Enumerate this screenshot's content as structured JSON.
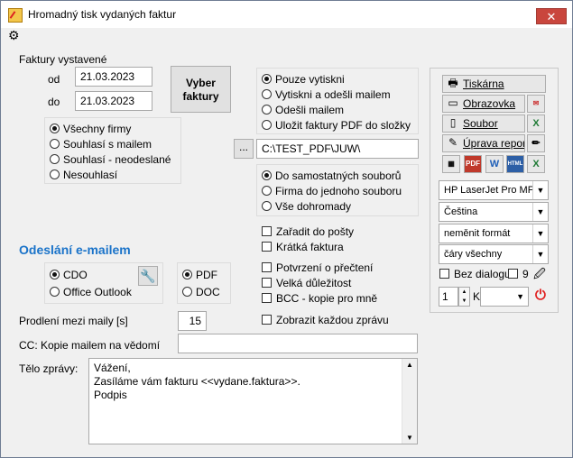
{
  "window": {
    "title": "Hromadný tisk vydaných faktur",
    "close_label": "✕"
  },
  "invoices": {
    "section_label": "Faktury vystavené",
    "from_label": "od",
    "from_value": "21.03.2023",
    "to_label": "do",
    "to_value": "21.03.2023",
    "select_button": "Vyber\nfaktury"
  },
  "companies": {
    "options": [
      "Všechny firmy",
      "Souhlasí s mailem",
      "Souhlasí - neodeslané",
      "Nesouhlasí"
    ],
    "selected": "Všechny firmy"
  },
  "action": {
    "options": [
      "Pouze vytiskni",
      "Vytiskni a odešli mailem",
      "Odešli mailem",
      "Uložit faktury PDF do složky"
    ],
    "selected": "Pouze vytiskni"
  },
  "folder": {
    "browse_label": "...",
    "path": "C:\\TEST_PDF\\JUW\\"
  },
  "files": {
    "options": [
      "Do samostatných souborů",
      "Firma do jednoho souboru",
      "Vše dohromady"
    ],
    "selected": "Do samostatných souborů"
  },
  "checks": {
    "mail_queue": "Zařadit do pošty",
    "short_invoice": "Krátká faktura",
    "read_receipt": "Potvrzení o přečtení",
    "high_priority": "Velká důležitost",
    "bcc_copy": "BCC - kopie pro mně",
    "show_each": "Zobrazit každou zprávu"
  },
  "email": {
    "heading": "Odeslání e-mailem",
    "client_options": [
      "CDO",
      "Office Outlook"
    ],
    "client_selected": "CDO",
    "format_options": [
      "PDF",
      "DOC"
    ],
    "format_selected": "PDF",
    "delay_label": "Prodlení mezi maily [s]",
    "delay_value": "15",
    "cc_label": "CC: Kopie mailem na vědomí",
    "cc_value": "",
    "body_label": "Tělo zprávy:",
    "body_lines": [
      "Vážení,",
      "Zasíláme vám fakturu <<vydane.faktura>>.",
      "Podpis"
    ]
  },
  "output": {
    "printer_btn": "Tiskárna",
    "screen_btn": "Obrazovka",
    "file_btn": "Soubor",
    "edit_btn": "Úprava repor",
    "printer_select": "HP LaserJet Pro MFP",
    "language_select": "Čeština",
    "format_select": "neměnit formát",
    "lines_select": "čáry všechny",
    "no_dialog_label": "Bez dialogu",
    "copies_value": "9",
    "count_value": "1",
    "k_label": "K",
    "export_labels": [
      "PDF",
      "W",
      "HTML"
    ]
  },
  "colors": {
    "accent": "#1a73c9",
    "close": "#c9463d"
  }
}
